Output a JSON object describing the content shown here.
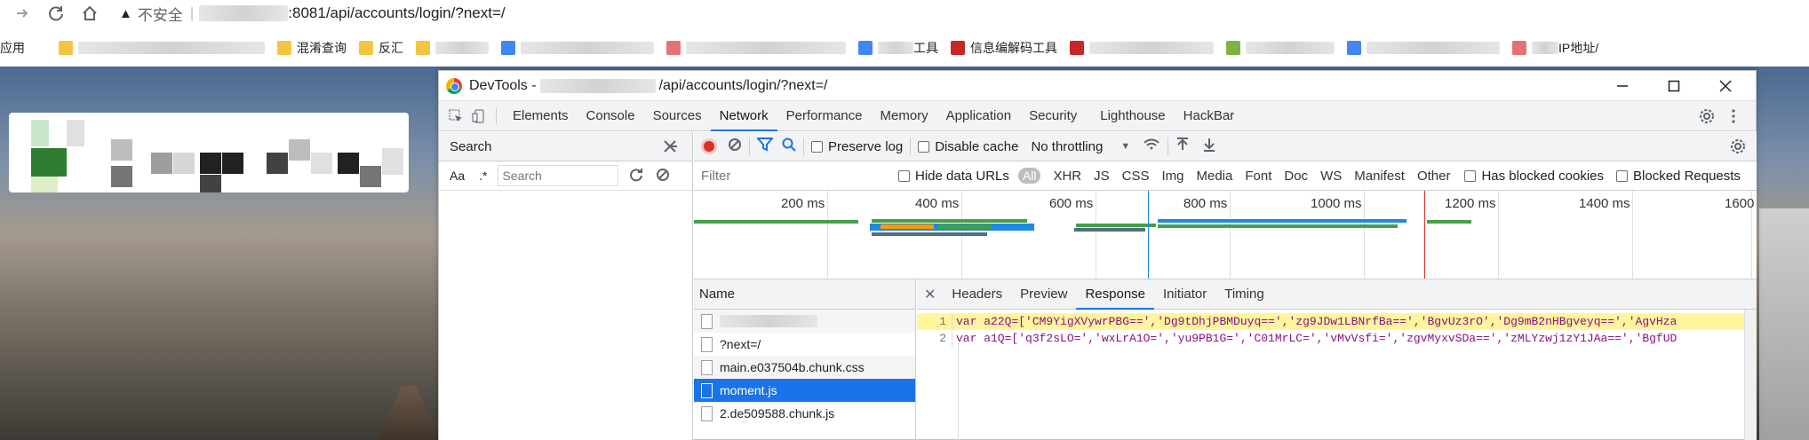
{
  "browser": {
    "insecure_label": "不安全",
    "url_visible": ":8081/api/accounts/login/?next=/",
    "bookmarks": [
      {
        "label": "应用",
        "color": "#4285f4"
      },
      {
        "label": "",
        "color": "#f4c542"
      },
      {
        "label": "混淆查询",
        "color": "#f4c542"
      },
      {
        "label": "反汇",
        "color": "#f4c542"
      },
      {
        "label": "",
        "color": "#4285f4"
      },
      {
        "label": "",
        "color": "#e57373"
      },
      {
        "label": "工具",
        "color": "#4285f4"
      },
      {
        "label": "信息编解码工具",
        "color": "#c62828"
      },
      {
        "label": "",
        "color": "#c62828"
      },
      {
        "label": "",
        "color": "#7cb342"
      },
      {
        "label": "",
        "color": "#4285f4"
      },
      {
        "label": "IP地址/",
        "color": "#e57373"
      }
    ]
  },
  "devtools": {
    "title_prefix": "DevTools -",
    "title_path": "/api/accounts/login/?next=/",
    "tabs": [
      "Elements",
      "Console",
      "Sources",
      "Network",
      "Performance",
      "Memory",
      "Application",
      "Security",
      "Lighthouse",
      "HackBar"
    ],
    "active_tab": "Network",
    "search_panel": {
      "title": "Search",
      "case_label": "Aa",
      "regex_label": ".*",
      "placeholder": "Search"
    },
    "toolbar": {
      "preserve_log": "Preserve log",
      "disable_cache": "Disable cache",
      "throttling": "No throttling"
    },
    "filter": {
      "placeholder": "Filter",
      "hide_data_urls": "Hide data URLs",
      "types": [
        "All",
        "XHR",
        "JS",
        "CSS",
        "Img",
        "Media",
        "Font",
        "Doc",
        "WS",
        "Manifest",
        "Other"
      ],
      "has_blocked_cookies": "Has blocked cookies",
      "blocked_requests": "Blocked Requests"
    },
    "timeline_ticks": [
      "200 ms",
      "400 ms",
      "600 ms",
      "800 ms",
      "1000 ms",
      "1200 ms",
      "1400 ms",
      "1600"
    ],
    "requests": {
      "header": "Name",
      "items": [
        "",
        "?next=/",
        "main.e037504b.chunk.css",
        "moment.js",
        "2.de509588.chunk.js"
      ],
      "selected": "moment.js"
    },
    "detail_tabs": [
      "Headers",
      "Preview",
      "Response",
      "Initiator",
      "Timing"
    ],
    "active_detail_tab": "Response",
    "response_lines": [
      {
        "num": "1",
        "text": "var a22Q=['CM9YigXVywrPBG==','Dg9tDhjPBMDuyq==','zg9JDw1LBNrfBa==','BgvUz3rO','Dg9mB2nHBgveyq==','AgvHza"
      },
      {
        "num": "2",
        "text": "var a1Q=['q3f2sLO=','wxLrA1O=','yu9PB1G=','C01MrLC=','vMvVsfi=','zgvMyxvSDa==','zMLYzwj1zY1JAa==','BgfUD"
      }
    ]
  },
  "colors": {
    "selected_row": "#1a73e8",
    "active_tab_underline": "#1a73e8",
    "highlight_line": "#fff59d"
  }
}
